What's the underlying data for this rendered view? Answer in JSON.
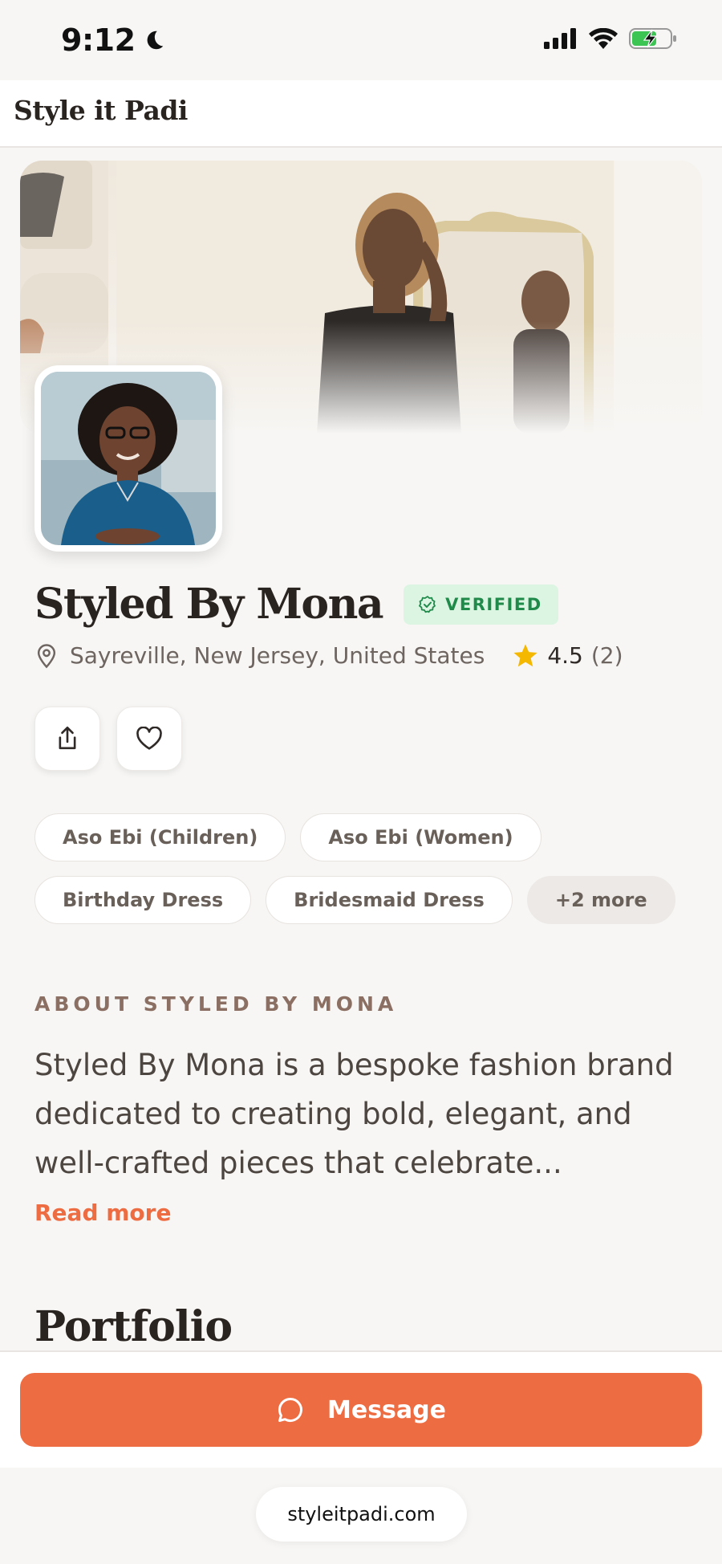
{
  "status_bar": {
    "time": "9:12"
  },
  "app": {
    "brand": "Style it Padi"
  },
  "profile": {
    "name": "Styled By Mona",
    "verified_label": "VERIFIED",
    "location": "Sayreville, New Jersey, United States",
    "rating": "4.5",
    "review_count": "(2)",
    "tags_row1": [
      "Aso Ebi (Children)",
      "Aso Ebi (Women)"
    ],
    "tags_row2": [
      "Birthday Dress",
      "Bridesmaid Dress"
    ],
    "more_tags": "+2 more"
  },
  "about": {
    "heading": "ABOUT STYLED BY MONA",
    "text": "Styled By Mona is a bespoke fashion brand dedicated to creating bold, elegant, and well-crafted pieces that celebrate...",
    "read_more": "Read more"
  },
  "portfolio": {
    "heading": "Portfolio"
  },
  "actions": {
    "message_label": "Message"
  },
  "browser": {
    "url": "styleitpadi.com"
  },
  "colors": {
    "accent": "#ee6c42",
    "verified_bg": "#dcf5e3",
    "verified_text": "#1f8a49",
    "star": "#f5b800"
  },
  "icons": {
    "moon": "moon-icon",
    "signal": "signal-icon",
    "wifi": "wifi-icon",
    "battery": "battery-charging-icon",
    "share": "share-icon",
    "favorite": "heart-icon",
    "location": "location-pin-icon",
    "star": "star-icon",
    "verified": "check-circle-icon",
    "message": "chat-bubble-icon"
  }
}
